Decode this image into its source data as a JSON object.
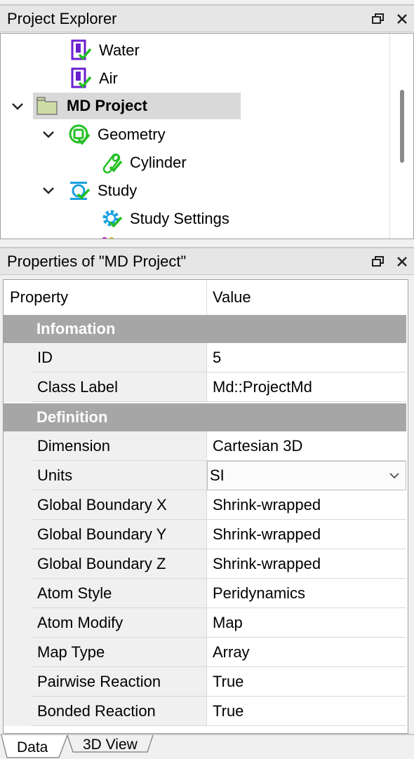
{
  "explorer": {
    "title": "Project Explorer",
    "items": [
      {
        "label": "Water",
        "icon": "material-icon"
      },
      {
        "label": "Air",
        "icon": "material-icon"
      },
      {
        "label": "MD Project",
        "icon": "folder-icon",
        "expanded": true,
        "selected": true
      },
      {
        "label": "Geometry",
        "icon": "geometry-icon",
        "expanded": true
      },
      {
        "label": "Cylinder",
        "icon": "cylinder-icon"
      },
      {
        "label": "Study",
        "icon": "study-icon",
        "expanded": true
      },
      {
        "label": "Study Settings",
        "icon": "gear-icon"
      }
    ]
  },
  "properties": {
    "title": "Properties of \"MD Project\"",
    "columns": {
      "property": "Property",
      "value": "Value"
    },
    "groups": [
      {
        "name": "Infomation",
        "rows": [
          {
            "name": "ID",
            "value": "5"
          },
          {
            "name": "Class Label",
            "value": "Md::ProjectMd"
          }
        ]
      },
      {
        "name": "Definition",
        "rows": [
          {
            "name": "Dimension",
            "value": "Cartesian 3D"
          },
          {
            "name": "Units",
            "value": "SI",
            "control": "dropdown"
          },
          {
            "name": "Global Boundary X",
            "value": "Shrink-wrapped"
          },
          {
            "name": "Global Boundary Y",
            "value": "Shrink-wrapped"
          },
          {
            "name": "Global Boundary Z",
            "value": "Shrink-wrapped"
          },
          {
            "name": "Atom Style",
            "value": "Peridynamics"
          },
          {
            "name": "Atom Modify",
            "value": "Map"
          },
          {
            "name": "Map Type",
            "value": "Array"
          },
          {
            "name": "Pairwise Reaction",
            "value": "True"
          },
          {
            "name": "Bonded Reaction",
            "value": "True"
          }
        ]
      }
    ]
  },
  "tabs": [
    {
      "label": "Data",
      "active": true
    },
    {
      "label": "3D View",
      "active": false
    }
  ],
  "colors": {
    "group_header": "#a6a6a6",
    "check": "#22c022",
    "material": "#6a1fd0",
    "study": "#1aa0e0"
  }
}
